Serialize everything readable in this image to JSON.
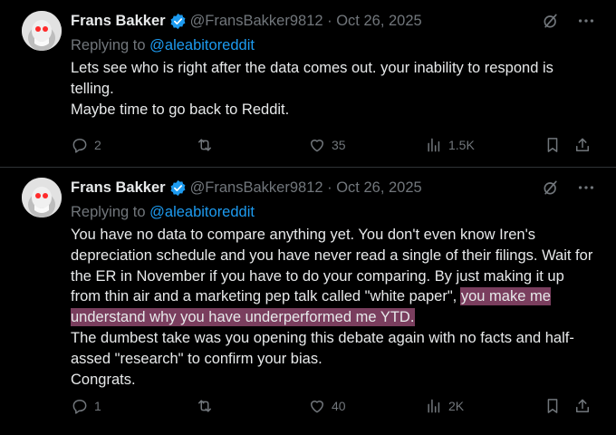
{
  "tweets": [
    {
      "author": "Frans Bakker",
      "handle": "@FransBakker9812 · Oct 26, 2025",
      "replying_prefix": "Replying to ",
      "replying_to": "@aleabitoreddit",
      "paragraphs": [
        "Lets see who is right after the data comes out. your inability to respond is telling.",
        "Maybe time to go back to Reddit."
      ],
      "replies": "2",
      "retweets": "",
      "likes": "35",
      "views": "1.5K"
    },
    {
      "author": "Frans Bakker",
      "handle": "@FransBakker9812 · Oct 26, 2025",
      "replying_prefix": "Replying to ",
      "replying_to": "@aleabitoreddit",
      "paragraph1_plain": "You have no data to compare anything yet. You don't even know Iren's depreciation schedule and you have never read a single of their filings. Wait for the ER in November if you have to do your comparing. By just making it up from thin air and a marketing pep talk called \"white paper\", ",
      "paragraph1_highlight": "you make me understand why you have underperformed me YTD.",
      "paragraph2": "The dumbest take was you opening this debate again with no facts and half-assed \"research\" to confirm your bias.",
      "paragraph3": "Congrats.",
      "replies": "1",
      "retweets": "",
      "likes": "40",
      "views": "2K"
    }
  ],
  "colors": {
    "background": "#000000",
    "text": "#e7e9ea",
    "muted": "#71767b",
    "link": "#1d9bf0",
    "verified": "#1d9bf0",
    "highlight": "#7a3e5e",
    "divider": "#2f3336"
  },
  "icons": [
    "avatar",
    "verified-icon",
    "grok-icon",
    "more-icon",
    "reply-icon",
    "retweet-icon",
    "like-icon",
    "views-icon",
    "bookmark-icon",
    "share-icon"
  ]
}
